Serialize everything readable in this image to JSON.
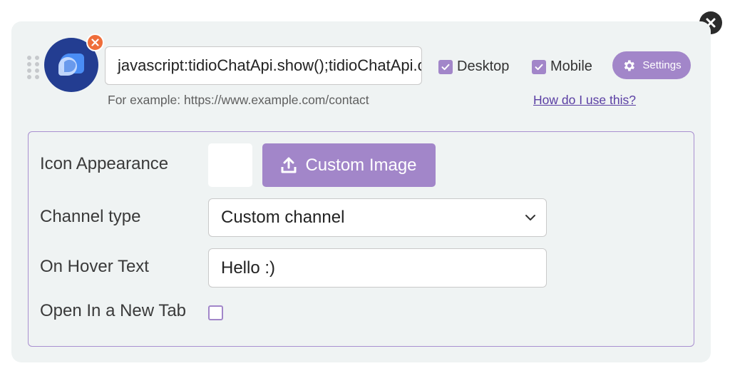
{
  "channel": {
    "url_value": "javascript:tidioChatApi.show();tidioChatApi.open();",
    "example_text": "For example: https://www.example.com/contact",
    "desktop_label": "Desktop",
    "mobile_label": "Mobile",
    "settings_label": "Settings",
    "howto_label": "How do I use this?"
  },
  "form": {
    "icon_appearance_label": "Icon Appearance",
    "custom_image_label": "Custom Image",
    "channel_type_label": "Channel type",
    "channel_type_value": "Custom channel",
    "hover_text_label": "On Hover Text",
    "hover_text_value": "Hello :)",
    "new_tab_label": "Open In a New Tab"
  },
  "state": {
    "desktop_checked": true,
    "mobile_checked": true,
    "new_tab_checked": false
  },
  "colors": {
    "accent": "#a286c9",
    "icon_bg": "#233d91",
    "remove_badge": "#ef6e3b",
    "link": "#5a3ea3",
    "card_bg": "#eff3f3"
  },
  "icons": {
    "close": "close-icon",
    "drag": "drag-handle-icon",
    "channel": "chat-bubbles-icon",
    "remove": "remove-icon",
    "check": "check-icon",
    "gear": "gear-icon",
    "upload": "upload-icon",
    "chevron": "chevron-down-icon"
  }
}
